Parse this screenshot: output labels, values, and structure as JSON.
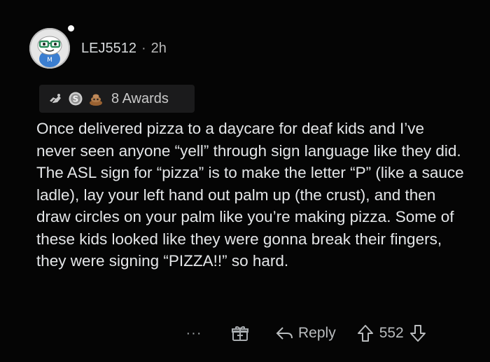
{
  "comment": {
    "author": "LEJ5512",
    "separator": "·",
    "time_ago": "2h",
    "awards_count_label": "8 Awards",
    "awards": [
      {
        "icon": "helping-hand-award-icon",
        "color": "#c9c9c9"
      },
      {
        "icon": "silver-award-icon",
        "color": "#d0d0d0"
      },
      {
        "icon": "poo-award-icon",
        "color": "#b07a4a"
      }
    ],
    "body": "Once delivered pizza to a daycare for deaf kids and I’ve never seen anyone “yell” through sign language like they did.  The ASL sign for “pizza” is to make the letter “P” (like a sauce ladle), lay your left hand out palm up (the crust), and then draw circles on your palm like you’re making pizza. Some of these kids looked like they were gonna break their fingers, they were signing “PIZZA!!” so hard."
  },
  "actions": {
    "more_label": "···",
    "reply_label": "Reply",
    "score": "552"
  }
}
